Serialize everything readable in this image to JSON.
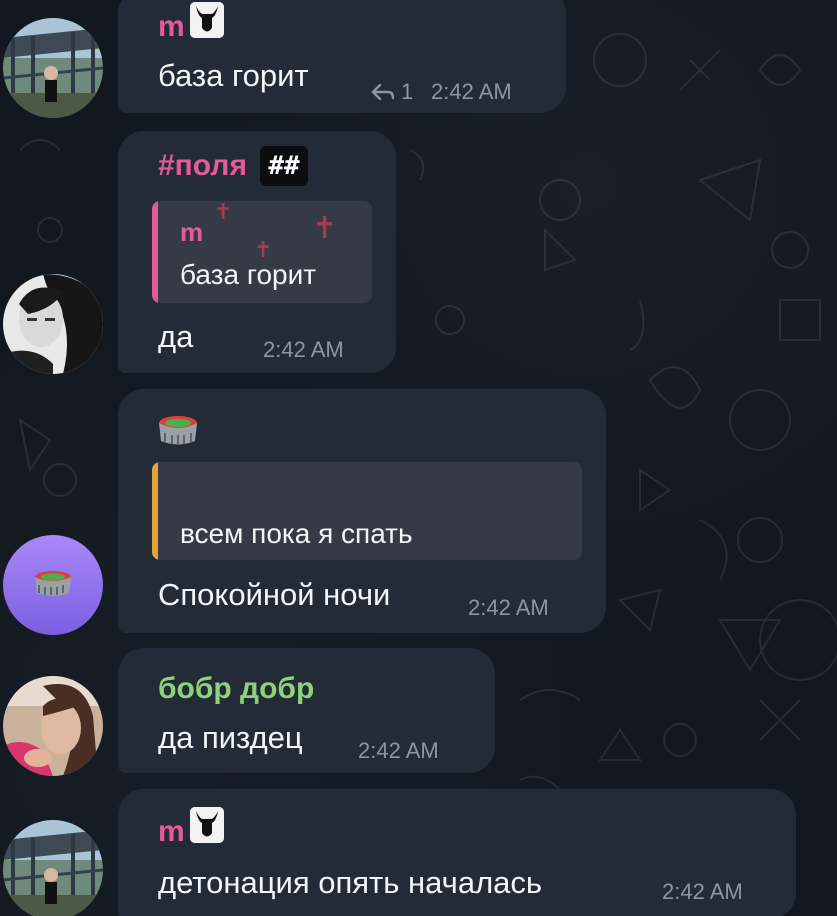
{
  "colors": {
    "background": "#121820",
    "bubble": "#232b36",
    "quote_bg": "#343b45",
    "sender_pink": "#e55b99",
    "sender_green": "#8fd17a",
    "quote_bar_pink": "#e05c98",
    "quote_bar_orange": "#e7a33b",
    "timestamp": "#8c95a1"
  },
  "messages": [
    {
      "sender": "m",
      "sender_badge_icon": "goat-skull-icon",
      "text": "база горит",
      "reply_icon": "reply-arrow-icon",
      "reply_count": "1",
      "time": "2:42 AM",
      "avatar_icon": "bridge-photo-avatar"
    },
    {
      "sender": "#поля",
      "sender_badge": "##",
      "quote": {
        "sender": "m",
        "text": "база горит"
      },
      "text": "да",
      "time": "2:42 AM",
      "avatar_icon": "bw-girl-photo-avatar"
    },
    {
      "sender_badge_icon": "stadium-emoji-icon",
      "quote": {
        "text": "всем пока я спать"
      },
      "text": "Спокойной ночи",
      "time": "2:42 AM",
      "avatar_icon": "stadium-purple-avatar"
    },
    {
      "sender": "бобр добр",
      "text": "да пиздец",
      "time": "2:42 AM",
      "avatar_icon": "girl-photo-avatar"
    },
    {
      "sender": "m",
      "sender_badge_icon": "goat-skull-icon",
      "text": "детонация опять началась",
      "time": "2:42 AM",
      "avatar_icon": "bridge-photo-avatar"
    }
  ]
}
